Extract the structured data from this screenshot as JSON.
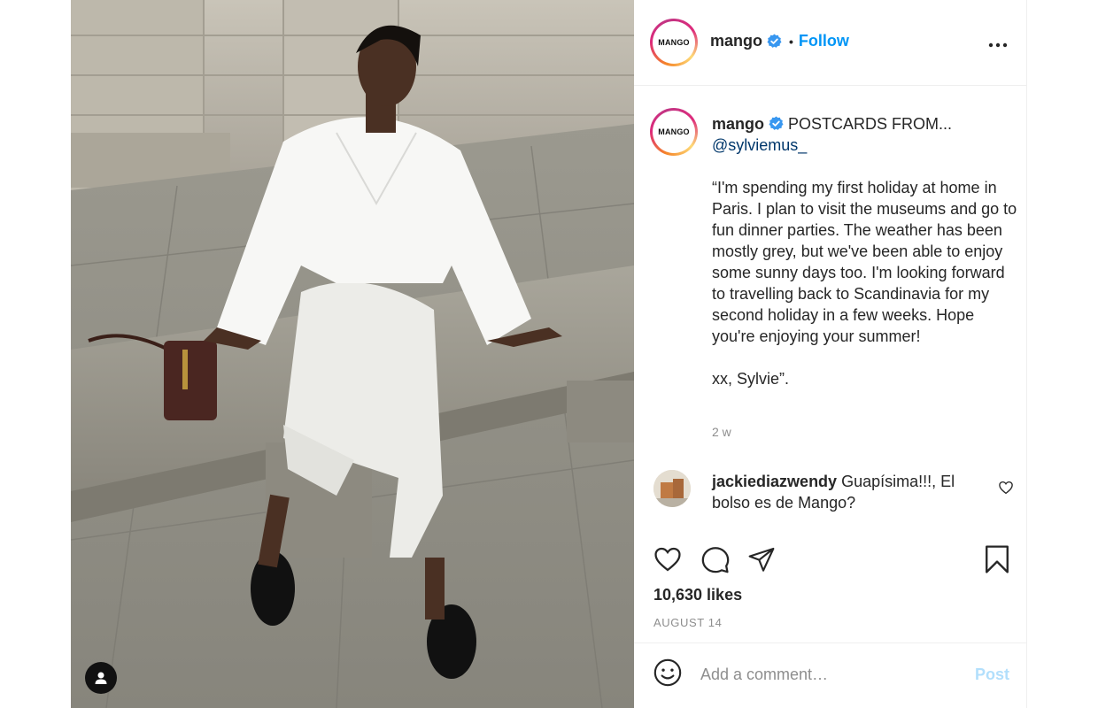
{
  "post": {
    "account_name": "mango",
    "avatar_text": "MANGO",
    "separator": "•",
    "follow_label": "Follow",
    "caption_title": "POSTCARDS FROM...",
    "caption_mention": "@sylviemus_",
    "caption_body": "“I'm spending my first holiday at home in Paris. I plan to visit the museums and go to fun dinner parties. The weather has been mostly grey, but we've been able to enjoy some sunny days too. I'm looking forward to travelling back to Scandinavia for my second holiday in a few weeks. Hope you're enjoying your summer!\n\nxx, Sylvie”.",
    "caption_time": "2 w",
    "likes": "10,630 likes",
    "date": "AUGUST 14"
  },
  "comments": [
    {
      "user": "jackiediazwendy",
      "text": "Guapísima!!!, El bolso es de Mango?"
    }
  ],
  "composer": {
    "placeholder": "Add a comment…",
    "post_label": "Post"
  },
  "icons": {
    "more": "more-options-icon",
    "verified": "verified-badge-icon",
    "like": "heart-icon",
    "comment": "comment-bubble-icon",
    "share": "paper-plane-icon",
    "save": "bookmark-icon",
    "emoji": "emoji-smile-icon",
    "tag": "user-tag-icon"
  },
  "colors": {
    "accent": "#0095f6",
    "verified": "#3897f0",
    "muted": "#8e8e8e",
    "post_disabled": "#b2dffc"
  }
}
